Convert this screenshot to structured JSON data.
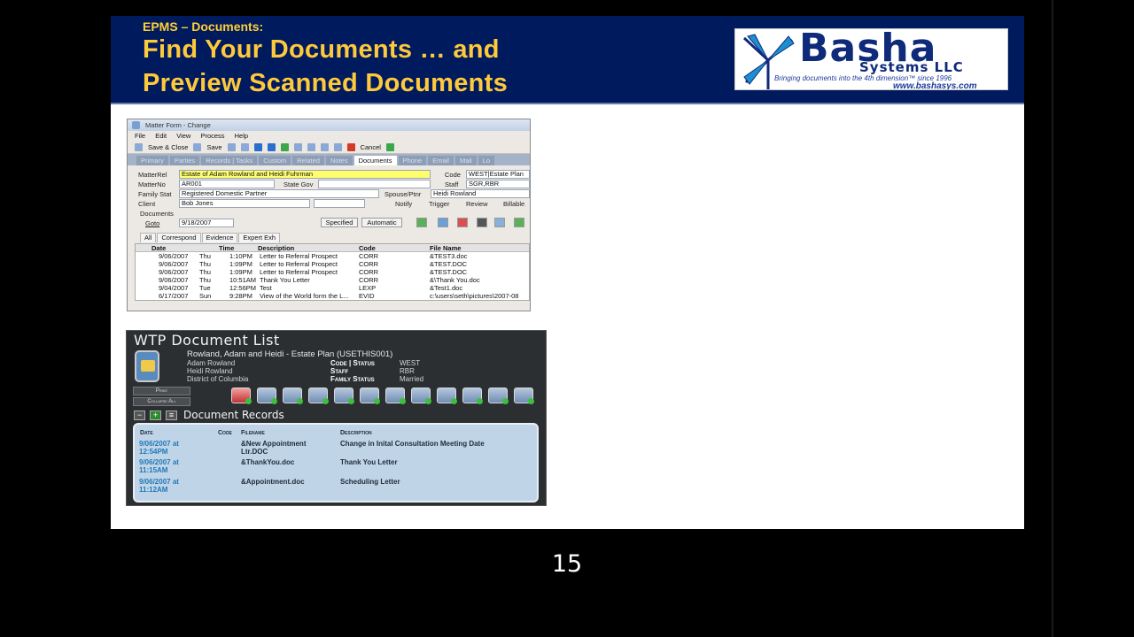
{
  "banner": {
    "eyebrow": "EPMS – Documents:",
    "title_line1": "Find Your Documents … and",
    "title_line2": "Preview Scanned Documents"
  },
  "logo": {
    "name": "Basha",
    "sub": "Systems LLC",
    "tagline": "Bringing documents into the 4th dimension™ since 1996",
    "url": "www.bashasys.com"
  },
  "matter_form": {
    "title": "Matter Form - Change",
    "menu": [
      "File",
      "Edit",
      "View",
      "Process",
      "Help"
    ],
    "toolbar": {
      "save_close": "Save & Close",
      "save": "Save",
      "cancel": "Cancel"
    },
    "tabs": [
      "Primary",
      "Parties",
      "Records | Tasks",
      "Custom",
      "Related",
      "Notes",
      "Documents",
      "Phone",
      "Email",
      "Mail",
      "Lo"
    ],
    "active_tab": "Documents",
    "fields": {
      "matterrel_label": "MatterRel",
      "matterrel": "Estate of Adam Rowland and Heidi Fuhrman",
      "code_label": "Code",
      "code": "WEST|Estate Plan",
      "matterno_label": "MatterNo",
      "matterno": "AR001",
      "state_gov_label": "State Gov",
      "staff_label": "Staff",
      "staff": "SGR,RBR",
      "family_stat_label": "Family Stat",
      "family_stat": "Registered Domestic Partner",
      "spouse_label": "Spouse/Ptnr",
      "spouse": "Heidi Rowland",
      "client_label": "Client",
      "client": "Bob Jones",
      "notify": "Notify",
      "trigger": "Trigger",
      "review": "Review",
      "billable": "Billable",
      "documents_label": "Documents",
      "goto_label": "Goto",
      "goto_date": "9/18/2007",
      "specified": "Specified",
      "automatic": "Automatic"
    },
    "subtabs": [
      "All",
      "Correspond",
      "Evidence",
      "Expert Exh"
    ],
    "columns": [
      "Date",
      "Time",
      "Description",
      "Code",
      "File Name"
    ],
    "rows": [
      {
        "date": "9/06/2007",
        "day": "Thu",
        "time": "1:10PM",
        "desc": "Letter to Referral Prospect",
        "code": "CORR",
        "file": "&TEST3.doc"
      },
      {
        "date": "9/06/2007",
        "day": "Thu",
        "time": "1:09PM",
        "desc": "Letter to Referral Prospect",
        "code": "CORR",
        "file": "&TEST.DOC"
      },
      {
        "date": "9/06/2007",
        "day": "Thu",
        "time": "1:09PM",
        "desc": "Letter to Referral Prospect",
        "code": "CORR",
        "file": "&TEST.DOC"
      },
      {
        "date": "9/06/2007",
        "day": "Thu",
        "time": "10:51AM",
        "desc": "Thank You Letter",
        "code": "CORR",
        "file": "&\\Thank You.doc"
      },
      {
        "date": "9/04/2007",
        "day": "Tue",
        "time": "12:56PM",
        "desc": "Test",
        "code": "LEXP",
        "file": "&Test1.doc"
      },
      {
        "date": "6/17/2007",
        "day": "Sun",
        "time": "9:28PM",
        "desc": "View of the World form the L...",
        "code": "EVID",
        "file": "c:\\users\\seth\\pictures\\2007-08"
      }
    ]
  },
  "wtp": {
    "title": "WTP Document List",
    "matter": "Rowland, Adam and Heidi - Estate Plan  (USETHIS001)",
    "person1": "Adam Rowland",
    "person2": "Heidi Rowland",
    "location": "District of Columbia",
    "code_status_label": "Code | Status",
    "code_status": "WEST",
    "staff_label": "Staff",
    "staff": "RBR",
    "family_status_label": "Family Status",
    "family_status": "Married",
    "print": "Print",
    "collapse_all": "Collapse All",
    "section_title": "Document Records",
    "columns": [
      "Date",
      "Code",
      "Filename",
      "Description"
    ],
    "records": [
      {
        "date": "9/06/2007 at",
        "time": "12:54PM",
        "file1": "&New Appointment",
        "file2": "Ltr.DOC",
        "desc": "Change in Inital Consultation Meeting Date"
      },
      {
        "date": "9/06/2007 at",
        "time": "11:15AM",
        "file1": "&ThankYou.doc",
        "file2": "",
        "desc": "Thank You Letter"
      },
      {
        "date": "9/06/2007 at",
        "time": "11:12AM",
        "file1": "&Appointment.doc",
        "file2": "",
        "desc": "Scheduling Letter"
      }
    ]
  },
  "page_number": "15"
}
